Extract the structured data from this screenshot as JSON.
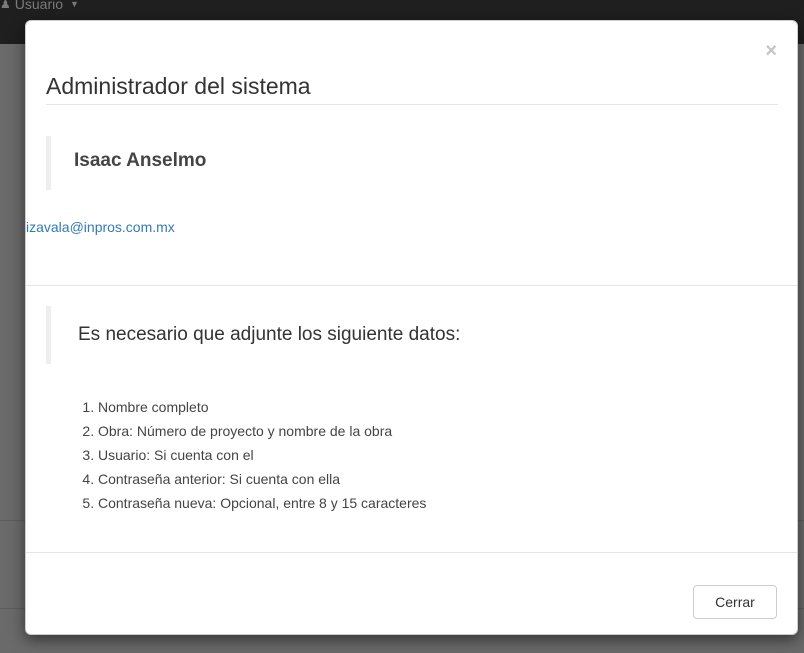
{
  "navbar": {
    "user_icon": "user-icon",
    "user_label": "Usuario",
    "caret_icon": "caret-down-icon"
  },
  "modal": {
    "close_label": "×",
    "title": "Administrador del sistema",
    "contact_name": "Isaac Anselmo",
    "email": "izavala@inpros.com.mx",
    "requirements_heading": "Es necesario que adjunte los siguiente datos:",
    "requirements": [
      "Nombre completo",
      "Obra: Número de proyecto y nombre de la obra",
      "Usuario: Si cuenta con el",
      "Contraseña anterior: Si cuenta con ella",
      "Contraseña nueva: Opcional, entre 8 y 15 caracteres"
    ],
    "close_button_label": "Cerrar"
  },
  "colors": {
    "link": "#337ab7",
    "navbar": "#1f1f1f",
    "backdrop": "#6e6e6e"
  }
}
